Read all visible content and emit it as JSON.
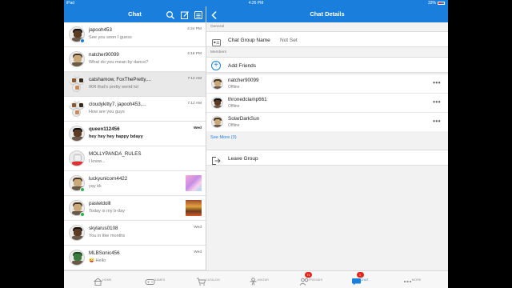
{
  "status_bar": {
    "device": "iPad",
    "time": "4:26 PM",
    "battery": "33%"
  },
  "chat_panel": {
    "title": "Chat",
    "icons": [
      "search-icon",
      "compose-icon",
      "menu-icon"
    ],
    "rows": [
      {
        "name": "japooh453",
        "preview": "See you soon I guess",
        "time": "4:24 PM",
        "unread": false,
        "avatar": "dark",
        "online": "blue",
        "thumb": null
      },
      {
        "name": "natcher90099",
        "preview": "What do you mean by dance?",
        "time": "4:18 PM",
        "unread": false,
        "avatar": "plain",
        "online": null,
        "thumb": null
      },
      {
        "name": "catshamow, FoxThePretty,...",
        "preview": "IKR that's pretty weird lol",
        "time": "7:12 AM",
        "unread": false,
        "avatar": "group",
        "online": null,
        "thumb": null,
        "selected": true
      },
      {
        "name": "cloudykitty7, japooh453,...",
        "preview": "How are you guys",
        "time": "7:12 AM",
        "unread": false,
        "avatar": "group",
        "online": null,
        "thumb": null
      },
      {
        "name": "queen112456",
        "preview": "hey hey hey happy bdayy",
        "time": "Wed",
        "unread": true,
        "avatar": "dark",
        "online": null,
        "thumb": null
      },
      {
        "name": "MOLLYPANDA_RULES",
        "preview": "I know...",
        "time": "",
        "unread": false,
        "avatar": "white",
        "online": null,
        "thumb": null
      },
      {
        "name": "luckyunicorn4422",
        "preview": "yay kk",
        "time": "",
        "unread": false,
        "avatar": "plain",
        "online": "green",
        "thumb": "pink"
      },
      {
        "name": "pasteldolll",
        "preview": "Today is my b-day",
        "time": "",
        "unread": false,
        "avatar": "plain",
        "online": "green",
        "thumb": "cake"
      },
      {
        "name": "skylarus0108",
        "preview": "You in like months",
        "time": "Wed",
        "unread": false,
        "avatar": "dark",
        "online": null,
        "thumb": null
      },
      {
        "name": "MLBSonic456",
        "preview": "😜 Hello",
        "time": "Wed",
        "unread": false,
        "avatar": "green",
        "online": null,
        "thumb": null
      }
    ]
  },
  "details_panel": {
    "title": "Chat Details",
    "general_label": "General",
    "group_name_label": "Chat Group Name",
    "group_name_value": "Not Set",
    "members_label": "Members",
    "add_friends_label": "Add Friends",
    "members": [
      {
        "name": "natcher90099",
        "status": "Offline",
        "avatar": "plain"
      },
      {
        "name": "thronedclamp661",
        "status": "Offline",
        "avatar": "dark"
      },
      {
        "name": "SolarDarkSun",
        "status": "Offline",
        "avatar": "plain"
      }
    ],
    "more_label": "•••",
    "see_more_label": "See More (3)",
    "leave_label": "Leave Group"
  },
  "bottom_nav": [
    {
      "label": "HOME",
      "icon": "home-icon",
      "badge": "",
      "active": false
    },
    {
      "label": "GAMES",
      "icon": "gamepad-icon",
      "badge": "",
      "active": false
    },
    {
      "label": "CATALOG",
      "icon": "cart-icon",
      "badge": "",
      "active": false
    },
    {
      "label": "AVATAR",
      "icon": "avatar-icon",
      "badge": "",
      "active": false
    },
    {
      "label": "FRIENDS",
      "icon": "friends-icon",
      "badge": "71",
      "active": false
    },
    {
      "label": "CHAT",
      "icon": "chat-icon",
      "badge": "1",
      "active": true
    },
    {
      "label": "MORE",
      "icon": "more-icon",
      "badge": "",
      "active": false
    }
  ],
  "colors": {
    "accent": "#1a7fdc",
    "badge": "#e2241b",
    "online": "#2bb24c"
  }
}
